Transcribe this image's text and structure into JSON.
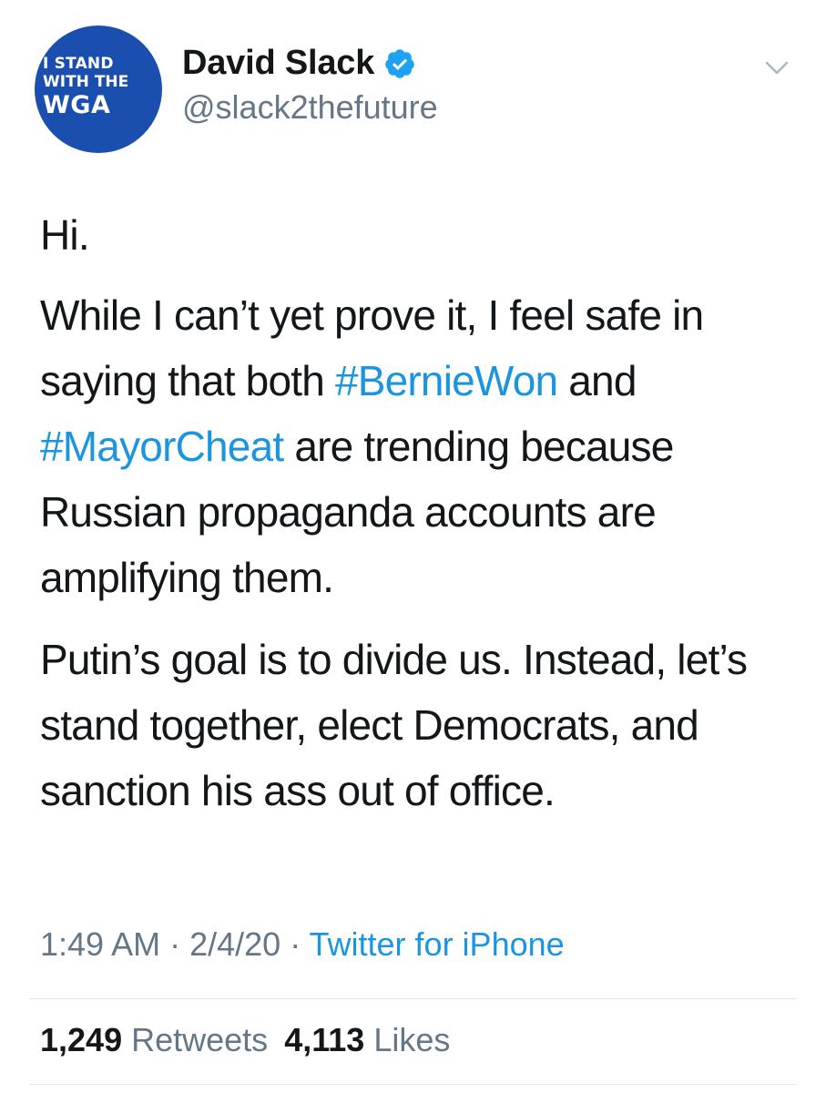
{
  "avatar": {
    "line1": "I STAND",
    "line2": "WITH THE",
    "line3": "WGA",
    "background_color": "#1a4fb0"
  },
  "user": {
    "display_name": "David Slack",
    "handle": "@slack2thefuture",
    "verified_icon": "verified-badge-icon"
  },
  "menu_icon": "chevron-down-icon",
  "tweet": {
    "p1": "Hi.",
    "p2_part1": "While I can’t yet prove it, I feel safe in saying that both ",
    "p2_hashtag1": "#BernieWon",
    "p2_part2": " and ",
    "p2_hashtag2": "#MayorCheat",
    "p2_part3": " are trending because Russian propaganda accounts are amplifying them.",
    "p3": "Putin’s goal is to divide us. Instead, let’s stand together, elect Democrats, and sanction his ass out of office."
  },
  "meta": {
    "time": "1:49 AM",
    "separator1": " · ",
    "date": "2/4/20",
    "separator2": " · ",
    "source": "Twitter for iPhone"
  },
  "stats": {
    "retweets_count": "1,249",
    "retweets_label": "Retweets",
    "likes_count": "4,113",
    "likes_label": "Likes"
  },
  "colors": {
    "link": "#1b95e0",
    "secondary_text": "#657786",
    "primary_text": "#14171a",
    "divider": "#e1e8ed"
  }
}
